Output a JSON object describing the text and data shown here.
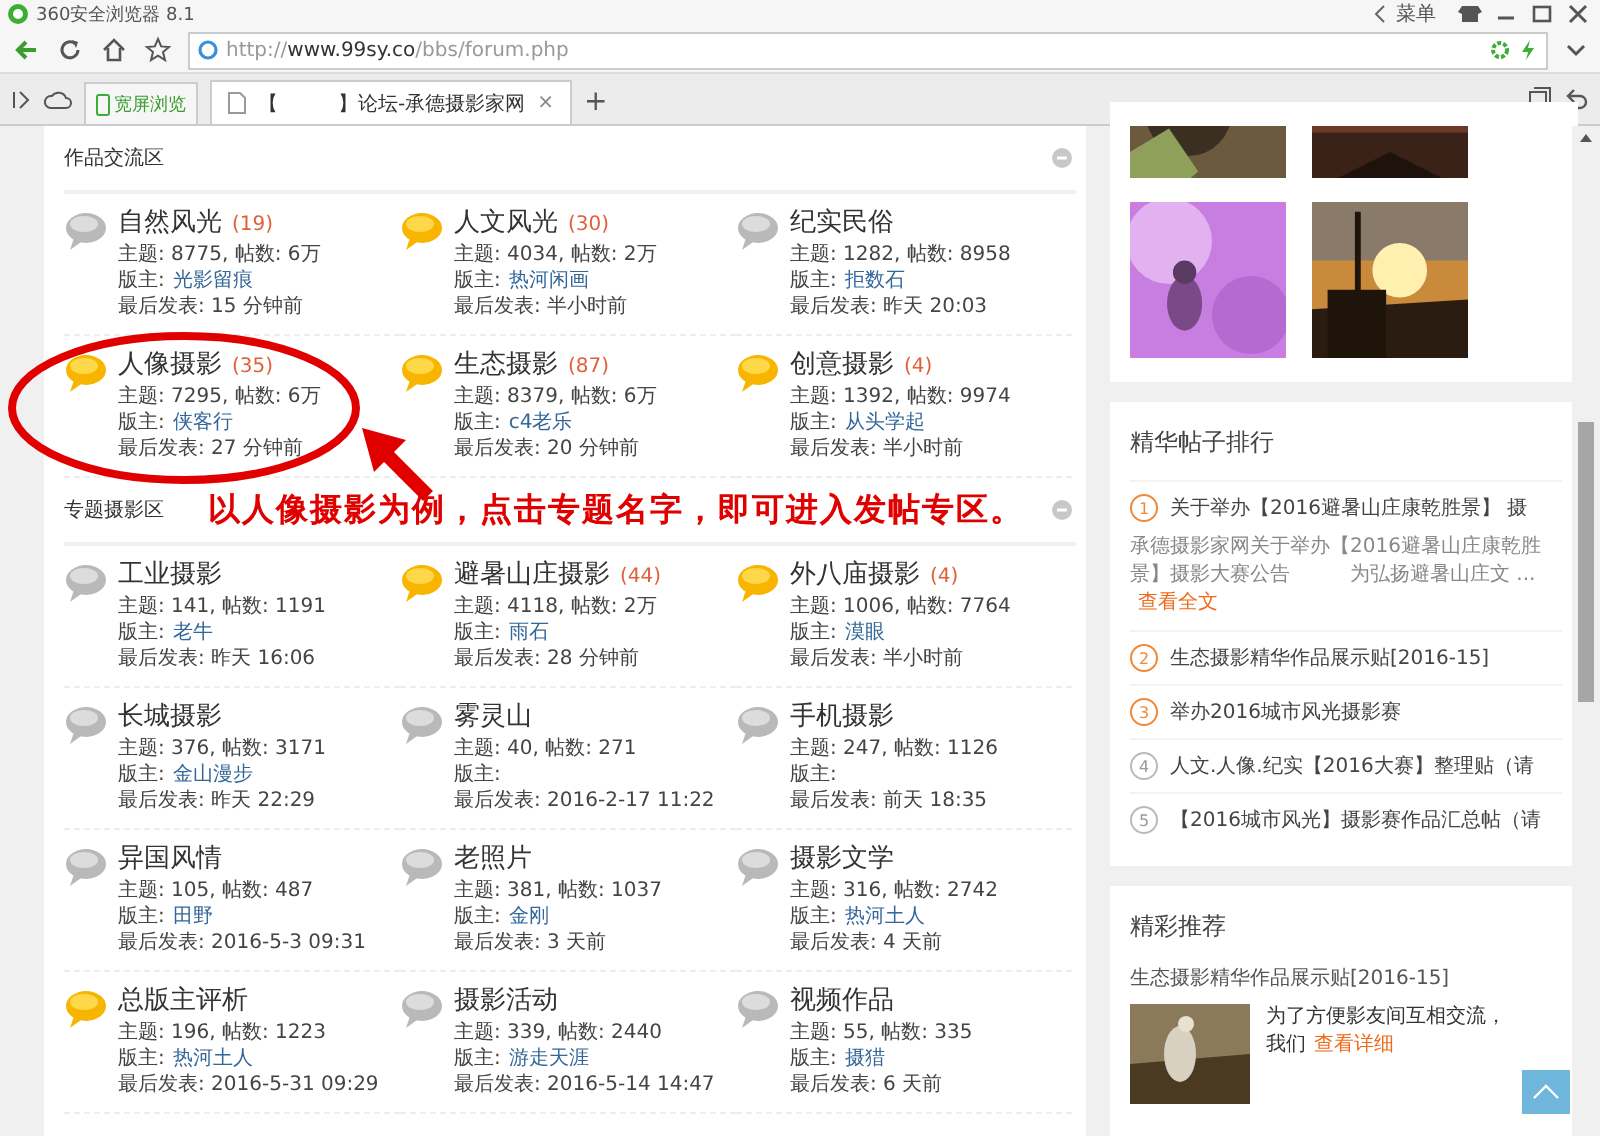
{
  "browser": {
    "title": "360安全浏览器 8.1",
    "menu": "菜单",
    "url_prefix": "http://",
    "url_host": "www.99sy.co",
    "url_path": "/bbs/forum.php",
    "widescreen": "宽屏浏览",
    "tabs": [
      {
        "label": "【　　　】论坛-承德摄影家网",
        "close": "×",
        "selected": true
      }
    ],
    "new_tab": "+"
  },
  "sections": [
    {
      "title": "作品交流区",
      "forums": [
        {
          "name": "自然风光",
          "new_posts": "(19)",
          "unread": false,
          "stats": "主题: 8775, 帖数: 6万",
          "moderator_label": "版主:",
          "moderator": "光影留痕",
          "last_post": "最后发表: 15 分钟前"
        },
        {
          "name": "人文风光",
          "new_posts": "(30)",
          "unread": true,
          "stats": "主题: 4034, 帖数: 2万",
          "moderator_label": "版主:",
          "moderator": "热河闲画",
          "last_post": "最后发表: 半小时前"
        },
        {
          "name": "纪实民俗",
          "unread": false,
          "stats": "主题: 1282, 帖数: 8958",
          "moderator_label": "版主:",
          "moderator": "拒数石",
          "last_post": "最后发表: 昨天 20:03"
        },
        {
          "name": "人像摄影",
          "new_posts": "(35)",
          "unread": true,
          "stats": "主题: 7295, 帖数: 6万",
          "moderator_label": "版主:",
          "moderator": "侠客行",
          "last_post": "最后发表: 27 分钟前"
        },
        {
          "name": "生态摄影",
          "new_posts": "(87)",
          "unread": true,
          "stats": "主题: 8379, 帖数: 6万",
          "moderator_label": "版主:",
          "moderator": "c4老乐",
          "last_post": "最后发表: 20 分钟前"
        },
        {
          "name": "创意摄影",
          "new_posts": "(4)",
          "unread": true,
          "stats": "主题: 1392, 帖数: 9974",
          "moderator_label": "版主:",
          "moderator": "从头学起",
          "last_post": "最后发表: 半小时前"
        }
      ]
    },
    {
      "title": "专题摄影区",
      "note": "以人像摄影为例，点击专题名字，即可进入发帖专区。",
      "forums": [
        {
          "name": "工业摄影",
          "unread": false,
          "stats": "主题: 141, 帖数: 1191",
          "moderator_label": "版主:",
          "moderator": "老牛",
          "last_post": "最后发表: 昨天 16:06"
        },
        {
          "name": "避暑山庄摄影",
          "new_posts": "(44)",
          "unread": true,
          "stats": "主题: 4118, 帖数: 2万",
          "moderator_label": "版主:",
          "moderator": "雨石",
          "last_post": "最后发表: 28 分钟前"
        },
        {
          "name": "外八庙摄影",
          "new_posts": "(4)",
          "unread": true,
          "stats": "主题: 1006, 帖数: 7764",
          "moderator_label": "版主:",
          "moderator": "漠眼",
          "last_post": "最后发表: 半小时前"
        },
        {
          "name": "长城摄影",
          "unread": false,
          "stats": "主题: 376, 帖数: 3171",
          "moderator_label": "版主:",
          "moderator": "金山漫步",
          "last_post": "最后发表: 昨天 22:29"
        },
        {
          "name": "雾灵山",
          "unread": false,
          "stats": "主题: 40, 帖数: 271",
          "moderator_label": "版主:",
          "last_post": "最后发表: 2016-2-17 11:22"
        },
        {
          "name": "手机摄影",
          "unread": false,
          "stats": "主题: 247, 帖数: 1126",
          "moderator_label": "版主:",
          "last_post": "最后发表: 前天 18:35"
        },
        {
          "name": "异国风情",
          "unread": false,
          "stats": "主题: 105, 帖数: 487",
          "moderator_label": "版主:",
          "moderator": "田野",
          "last_post": "最后发表: 2016-5-3 09:31"
        },
        {
          "name": "老照片",
          "unread": false,
          "stats": "主题: 381, 帖数: 1037",
          "moderator_label": "版主:",
          "moderator": "金刚",
          "last_post": "最后发表: 3 天前"
        },
        {
          "name": "摄影文学",
          "unread": false,
          "stats": "主题: 316, 帖数: 2742",
          "moderator_label": "版主:",
          "moderator": "热河土人",
          "last_post": "最后发表: 4 天前"
        },
        {
          "name": "总版主评析",
          "unread": true,
          "stats": "主题: 196, 帖数: 1223",
          "moderator_label": "版主:",
          "moderator": "热河土人",
          "last_post": "最后发表: 2016-5-31 09:29"
        },
        {
          "name": "摄影活动",
          "unread": false,
          "stats": "主题: 339, 帖数: 2440",
          "moderator_label": "版主:",
          "moderator": "游走天涯",
          "last_post": "最后发表: 2016-5-14 14:47"
        },
        {
          "name": "视频作品",
          "unread": false,
          "stats": "主题: 55, 帖数: 335",
          "moderator_label": "版主:",
          "moderator": "摄猎",
          "last_post": "最后发表: 6 天前"
        }
      ]
    }
  ],
  "sidebar": {
    "ranking": {
      "title": "精华帖子排行",
      "items": [
        {
          "rank": "1",
          "top": true,
          "title": "关于举办【2016避暑山庄康乾胜景】 摄",
          "excerpt": "承德摄影家网关于举办【2016避暑山庄康乾胜景】摄影大赛公告　　　为弘扬避暑山庄文 ...",
          "more": "查看全文"
        },
        {
          "rank": "2",
          "top": true,
          "title": "生态摄影精华作品展示贴[2016-15]"
        },
        {
          "rank": "3",
          "top": true,
          "title": "举办2016城市风光摄影赛"
        },
        {
          "rank": "4",
          "top": false,
          "title": "人文.人像.纪实【2016大赛】整理贴（请"
        },
        {
          "rank": "5",
          "top": false,
          "title": "【2016城市风光】摄影赛作品汇总帖（请"
        }
      ]
    },
    "recommend": {
      "title": "精彩推荐",
      "post": "生态摄影精华作品展示贴[2016-15]",
      "excerpt": "为了方便影友间互相交流，我们",
      "more": "查看详细"
    }
  }
}
